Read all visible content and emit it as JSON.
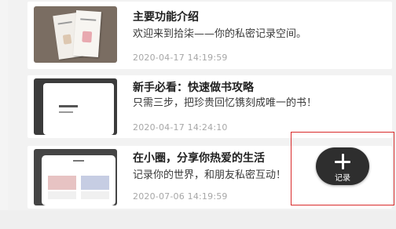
{
  "cards": [
    {
      "title": "主要功能介绍",
      "desc": "欢迎来到拾柒——你的私密记录空间。",
      "time": "2020-04-17 14:19:59"
    },
    {
      "title": "新手必看：快速做书攻略",
      "desc": "只需三步，把珍贵回忆镌刻成唯一的书！",
      "time": "2020-04-17 14:24:10"
    },
    {
      "title": "在小圈，分享你热爱的生活",
      "desc": "记录你的世界，和朋友私密互动！",
      "time": "2020-07-06 14:19:59"
    }
  ],
  "fab": {
    "icon": "plus-icon",
    "label": "记录"
  },
  "colors": {
    "background": "#f2f2f2",
    "card": "#ffffff",
    "highlight": "#d92b2b",
    "fab": "#2e2e2e"
  }
}
